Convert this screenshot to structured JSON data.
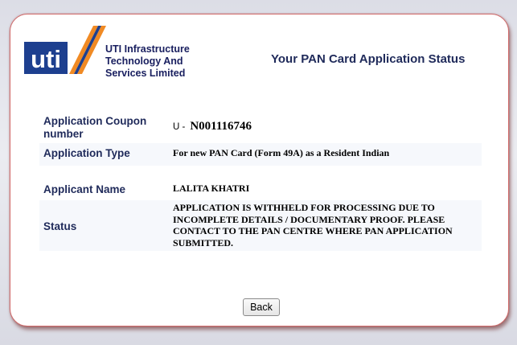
{
  "header": {
    "logo_text": "uti",
    "company_lines": [
      "UTI Infrastructure",
      "Technology And",
      "Services Limited"
    ],
    "page_title": "Your PAN Card Application Status"
  },
  "details": {
    "coupon": {
      "label": "Application Coupon number",
      "prefix": "U -",
      "number": "N001116746"
    },
    "application_type": {
      "label": "Application Type",
      "value": "For new PAN Card (Form 49A) as a Resident Indian"
    },
    "applicant_name": {
      "label": "Applicant Name",
      "value": "LALITA KHATRI"
    },
    "status": {
      "label": "Status",
      "value": "APPLICATION IS WITHHELD FOR PROCESSING DUE TO INCOMPLETE DETAILS / DOCUMENTARY PROOF. PLEASE CONTACT TO THE PAN CENTRE WHERE PAN APPLICATION SUBMITTED."
    }
  },
  "actions": {
    "back_label": "Back"
  },
  "colors": {
    "logo_blue": "#1d3f8f",
    "logo_orange": "#f08a24",
    "heading_navy": "#1f2a5a",
    "card_border": "#d06a6a"
  }
}
